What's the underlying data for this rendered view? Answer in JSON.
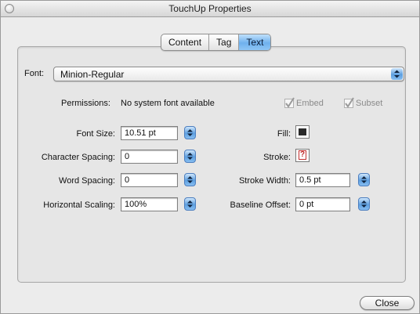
{
  "window": {
    "title": "TouchUp Properties"
  },
  "tabs": [
    {
      "label": "Content",
      "active": false
    },
    {
      "label": "Tag",
      "active": false
    },
    {
      "label": "Text",
      "active": true
    }
  ],
  "font": {
    "label": "Font:",
    "value": "Minion-Regular"
  },
  "permissions": {
    "label": "Permissions:",
    "value": "No system font available",
    "embed": {
      "label": "Embed",
      "checked": true,
      "enabled": false
    },
    "subset": {
      "label": "Subset",
      "checked": true,
      "enabled": false
    }
  },
  "left_fields": [
    {
      "label": "Font Size:",
      "value": "10.51 pt"
    },
    {
      "label": "Character Spacing:",
      "value": "0"
    },
    {
      "label": "Word Spacing:",
      "value": "0"
    },
    {
      "label": "Horizontal Scaling:",
      "value": "100%"
    }
  ],
  "fill": {
    "label": "Fill:",
    "color": "#2a2a2a"
  },
  "stroke": {
    "label": "Stroke:",
    "symbol": "?"
  },
  "right_fields": [
    {
      "label": "Stroke Width:",
      "value": "0.5 pt"
    },
    {
      "label": "Baseline Offset:",
      "value": "0 pt"
    }
  ],
  "buttons": {
    "close": "Close"
  },
  "colors": {
    "accent": "#6fb1ee"
  }
}
